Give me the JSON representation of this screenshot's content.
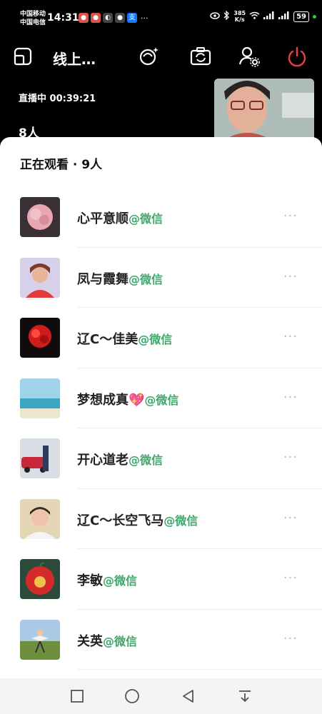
{
  "status_bar": {
    "carrier_1": "中国移动",
    "carrier_2": "中国电信",
    "time": "14:31",
    "net_speed_value": "385",
    "net_speed_unit": "K/s",
    "battery": "59",
    "more": "···"
  },
  "header": {
    "title": "线上…",
    "live_timer": "直播中 00:39:21",
    "audience_count": "8人"
  },
  "sheet": {
    "title": "正在观看 · 9人",
    "viewers": [
      {
        "name": "心平意顺",
        "tag": "@微信",
        "more": "···"
      },
      {
        "name": "凤与霞舞",
        "tag": "@微信",
        "more": "···"
      },
      {
        "name": "辽C～佳美",
        "tag": "@微信",
        "more": "···"
      },
      {
        "name": "梦想成真💖",
        "tag": "@微信",
        "more": "···"
      },
      {
        "name": "开心道老",
        "tag": "@微信",
        "more": "···"
      },
      {
        "name": "辽C～长空飞马",
        "tag": "@微信",
        "more": "···"
      },
      {
        "name": "李敏",
        "tag": "@微信",
        "more": "···"
      },
      {
        "name": " 关英",
        "tag": "@微信",
        "more": "···"
      }
    ]
  },
  "colors": {
    "accent_green": "#3ea86a",
    "power_red": "#e8453c"
  }
}
